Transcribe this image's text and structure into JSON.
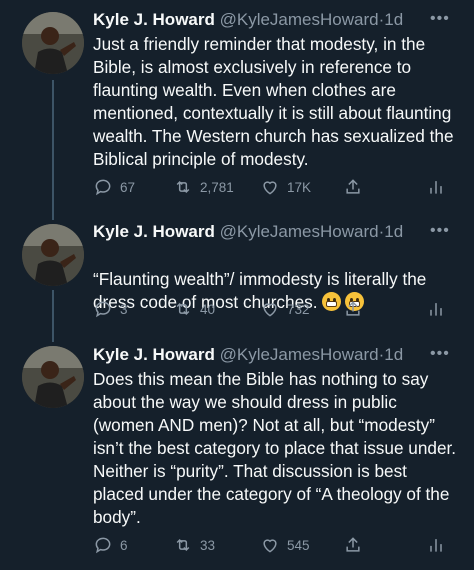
{
  "tweets": [
    {
      "name": "Kyle J. Howard",
      "handle": "@KyleJamesHoward",
      "sep": "·",
      "time": "1d",
      "more": "•••",
      "text": "Just a friendly reminder that modesty, in the Bible, is almost exclusively in reference to flaunting wealth. Even when clothes are mentioned, contextually it is still about flaunting wealth. The Western church has sexualized the Biblical principle of modesty.",
      "replies": "67",
      "retweets": "2,781",
      "likes": "17K"
    },
    {
      "name": "Kyle J. Howard",
      "handle": "@KyleJamesHoward",
      "sep": "·",
      "time": "1d",
      "more": "•••",
      "text": "“Flaunting wealth”/ immodesty is literally the dress code of most churches.",
      "emojis": [
        "grinning-sweat-emoji",
        "grimacing-emoji"
      ],
      "replies": "3",
      "retweets": "40",
      "likes": "732"
    },
    {
      "name": "Kyle J. Howard",
      "handle": "@KyleJamesHoward",
      "sep": "·",
      "time": "1d",
      "more": "•••",
      "text": "Does this mean the Bible has nothing to say about the way we should dress in public (women AND men)? Not at all, but “modesty” isn’t the best category to place that issue under. Neither is “purity”. That discussion is best placed under the category of “A theology of the body”.",
      "replies": "6",
      "retweets": "33",
      "likes": "545"
    }
  ],
  "icons": [
    "reply-icon",
    "retweet-icon",
    "like-icon",
    "share-icon",
    "analytics-icon"
  ],
  "colors": {
    "background": "#15202b",
    "text": "#f7f9f9",
    "muted": "#8b98a5",
    "thread": "#3d5466"
  }
}
